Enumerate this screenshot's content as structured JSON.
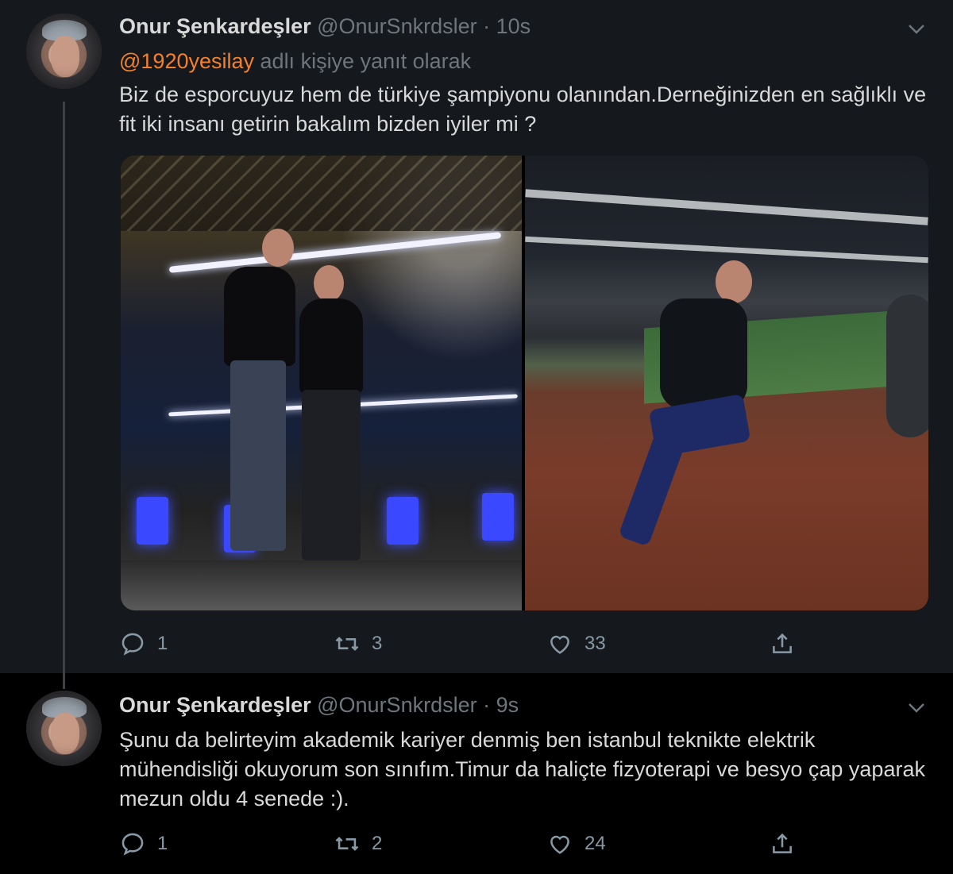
{
  "tweets": [
    {
      "author_name": "Onur Şenkardeşler",
      "handle": "@OnurSnkrdsler",
      "separator": "·",
      "time": "10s",
      "reply_mention": "@1920yesilay",
      "reply_suffix": "adlı kişiye yanıt olarak",
      "text": "Biz de esporcuyuz hem de türkiye şampiyonu olanından.Derneğinizden en sağlıklı ve fit iki insanı getirin bakalım bizden iyiler mi ?",
      "replies": "1",
      "retweets": "3",
      "likes": "33"
    },
    {
      "author_name": "Onur Şenkardeşler",
      "handle": "@OnurSnkrdsler",
      "separator": "·",
      "time": "9s",
      "text": "Şunu da belirteyim akademik kariyer denmiş ben istanbul teknikte elektrik mühendisliği okuyorum son sınıfım.Timur da haliçte fizyoterapi ve besyo çap yaparak mezun oldu 4 senede :).",
      "replies": "1",
      "retweets": "2",
      "likes": "24"
    }
  ],
  "icons": [
    "chevron-down-icon",
    "reply-icon",
    "retweet-icon",
    "like-icon",
    "share-icon"
  ],
  "colors": {
    "background": "#15181c",
    "mention": "#f4802a",
    "muted": "#6e767d"
  }
}
